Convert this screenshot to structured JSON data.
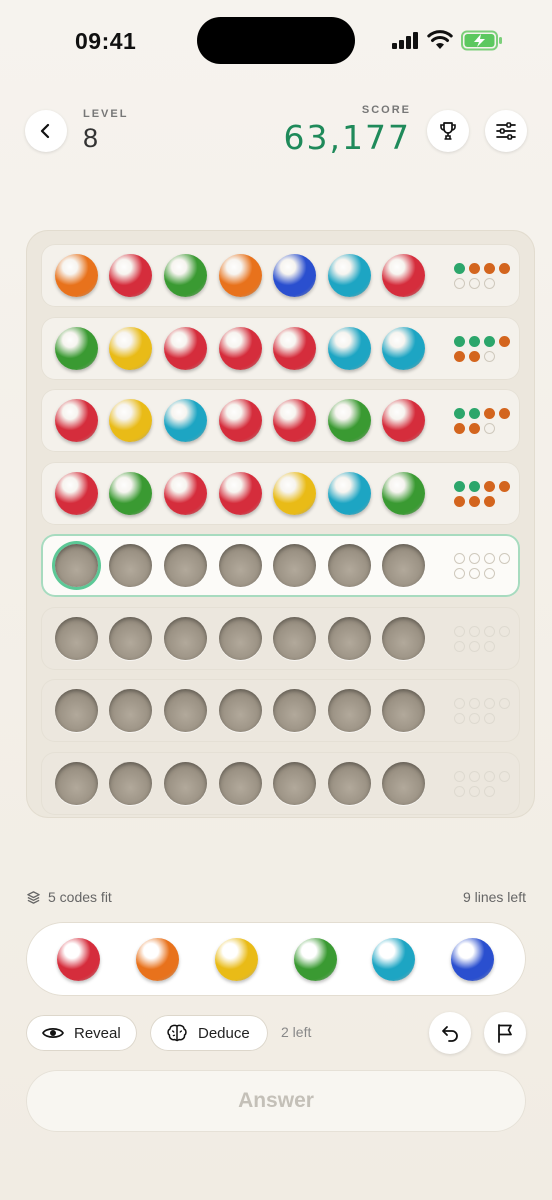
{
  "status_bar": {
    "time": "09:41"
  },
  "header": {
    "level_label": "LEVEL",
    "level_value": "8",
    "score_label": "SCORE",
    "score_value": "63,177"
  },
  "colors": {
    "red": "#d52d3c",
    "orange": "#e8721c",
    "yellow": "#e9bb17",
    "green": "#3a9a32",
    "teal": "#1da5c3",
    "blue": "#2a4fcf",
    "accent_green": "#1f8a5a",
    "feedback_exact": "#2ca66b",
    "feedback_partial": "#d3651e"
  },
  "board": {
    "rows": [
      {
        "state": "guessed",
        "pegs": [
          "orange",
          "red",
          "green",
          "orange",
          "blue",
          "teal",
          "red"
        ],
        "feedback": [
          "exact",
          "partial",
          "partial",
          "partial",
          "empty",
          "empty",
          "empty"
        ]
      },
      {
        "state": "guessed",
        "pegs": [
          "green",
          "yellow",
          "red",
          "red",
          "red",
          "teal",
          "teal"
        ],
        "feedback": [
          "exact",
          "exact",
          "exact",
          "partial",
          "partial",
          "partial",
          "empty"
        ]
      },
      {
        "state": "guessed",
        "pegs": [
          "red",
          "yellow",
          "teal",
          "red",
          "red",
          "green",
          "red"
        ],
        "feedback": [
          "exact",
          "exact",
          "partial",
          "partial",
          "partial",
          "partial",
          "empty"
        ]
      },
      {
        "state": "guessed",
        "pegs": [
          "red",
          "green",
          "red",
          "red",
          "yellow",
          "teal",
          "green"
        ],
        "feedback": [
          "exact",
          "exact",
          "partial",
          "partial",
          "partial",
          "partial",
          "partial"
        ]
      },
      {
        "state": "active",
        "pegs": [
          "empty",
          "empty",
          "empty",
          "empty",
          "empty",
          "empty",
          "empty"
        ],
        "feedback": [
          "empty",
          "empty",
          "empty",
          "empty",
          "empty",
          "empty",
          "empty"
        ]
      },
      {
        "state": "future",
        "pegs": [
          "empty",
          "empty",
          "empty",
          "empty",
          "empty",
          "empty",
          "empty"
        ],
        "feedback": [
          "faint",
          "faint",
          "faint",
          "faint",
          "faint",
          "faint",
          "faint"
        ]
      },
      {
        "state": "future",
        "pegs": [
          "empty",
          "empty",
          "empty",
          "empty",
          "empty",
          "empty",
          "empty"
        ],
        "feedback": [
          "faint",
          "faint",
          "faint",
          "faint",
          "faint",
          "faint",
          "faint"
        ]
      },
      {
        "state": "future",
        "pegs": [
          "empty",
          "empty",
          "empty",
          "empty",
          "empty",
          "empty",
          "empty"
        ],
        "feedback": [
          "faint",
          "faint",
          "faint",
          "faint",
          "faint",
          "faint",
          "faint"
        ]
      }
    ]
  },
  "info": {
    "codes_fit": "5 codes fit",
    "lines_left": "9 lines left"
  },
  "palette": [
    "red",
    "orange",
    "yellow",
    "green",
    "teal",
    "blue"
  ],
  "actions": {
    "reveal_label": "Reveal",
    "deduce_label": "Deduce",
    "remaining": "2 left",
    "answer_label": "Answer"
  },
  "icons": [
    "back-icon",
    "trophy-icon",
    "settings-sliders-icon",
    "layers-icon",
    "eye-icon",
    "brain-icon",
    "undo-icon",
    "flag-icon"
  ]
}
